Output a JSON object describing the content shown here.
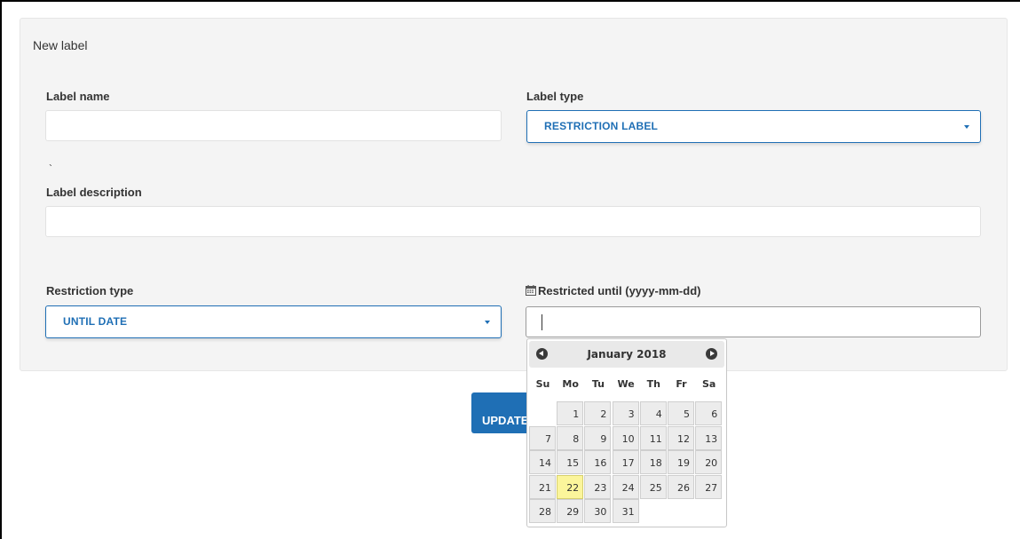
{
  "panel": {
    "title": "New label"
  },
  "fields": {
    "label_name": {
      "label": "Label name",
      "value": ""
    },
    "label_type": {
      "label": "Label type",
      "value": "RESTRICTION LABEL"
    },
    "tick_mark": "`",
    "label_description": {
      "label": "Label description",
      "value": ""
    },
    "restriction_type": {
      "label": "Restriction type",
      "value": "UNTIL DATE"
    },
    "restricted_until": {
      "label": "Restricted until (yyyy-mm-dd)",
      "value": ""
    }
  },
  "update_button": {
    "label": "UPDATE"
  },
  "datepicker": {
    "month_title": "January 2018",
    "weekdays": [
      "Su",
      "Mo",
      "Tu",
      "We",
      "Th",
      "Fr",
      "Sa"
    ],
    "weeks": [
      [
        "",
        "1",
        "2",
        "3",
        "4",
        "5",
        "6"
      ],
      [
        "7",
        "8",
        "9",
        "10",
        "11",
        "12",
        "13"
      ],
      [
        "14",
        "15",
        "16",
        "17",
        "18",
        "19",
        "20"
      ],
      [
        "21",
        "22",
        "23",
        "24",
        "25",
        "26",
        "27"
      ],
      [
        "28",
        "29",
        "30",
        "31",
        "",
        "",
        ""
      ]
    ],
    "highlighted_day": "22"
  },
  "colors": {
    "accent": "#1f6fb5",
    "panel_bg": "#f4f4f4",
    "today_highlight": "#fbf59b"
  },
  "icons": {
    "calendar": "calendar-icon",
    "prev": "chevron-left-icon",
    "next": "chevron-right-icon",
    "select_caret": "caret-down-icon"
  }
}
